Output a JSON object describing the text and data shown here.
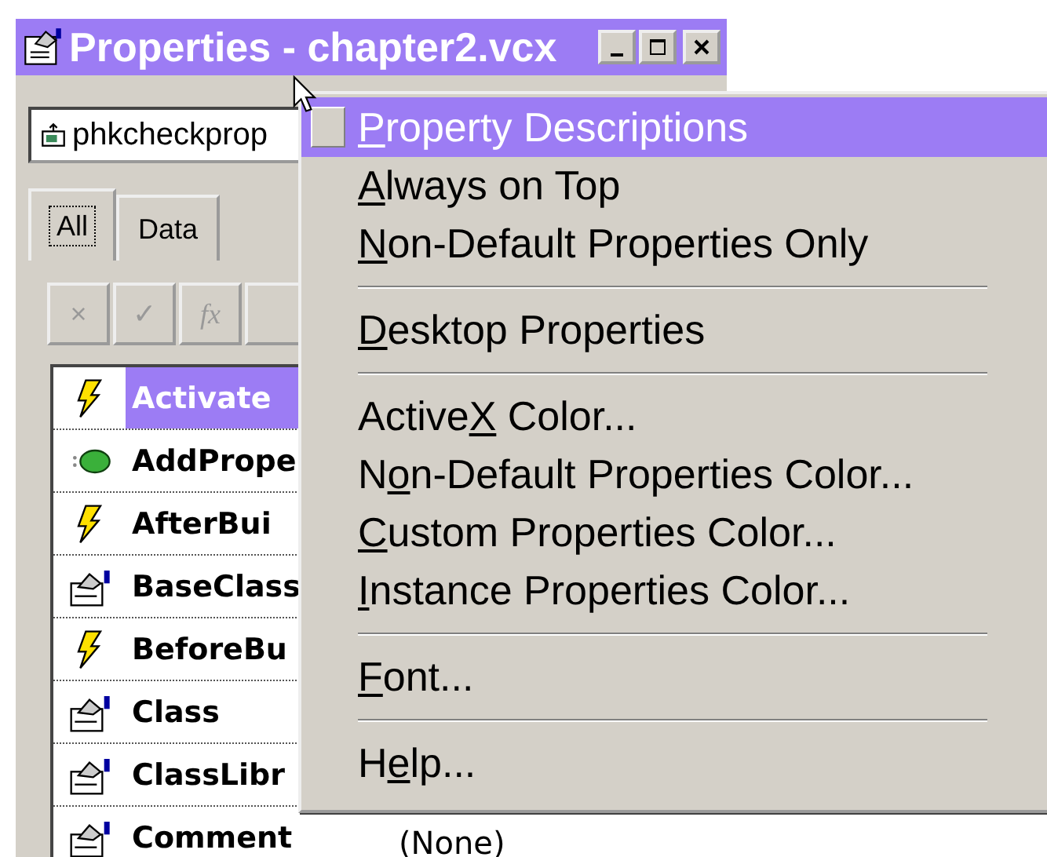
{
  "window": {
    "title": "Properties - chapter2.vcx"
  },
  "object_combo": {
    "value": "phkcheckprop"
  },
  "tabs": [
    {
      "label": "All",
      "selected": true
    },
    {
      "label": "Data",
      "selected": false
    }
  ],
  "toolbar": [
    {
      "label": "×"
    },
    {
      "label": "✓"
    },
    {
      "label": "fx"
    }
  ],
  "properties": [
    {
      "name": "Activate",
      "kind": "event",
      "selected": true
    },
    {
      "name": "AddPrope",
      "kind": "method",
      "selected": false
    },
    {
      "name": "AfterBui",
      "kind": "event",
      "selected": false
    },
    {
      "name": "BaseClass",
      "kind": "property",
      "selected": false
    },
    {
      "name": "BeforeBu",
      "kind": "event",
      "selected": false
    },
    {
      "name": "Class",
      "kind": "property",
      "selected": false
    },
    {
      "name": "ClassLibr",
      "kind": "property",
      "selected": false
    },
    {
      "name": "Comment",
      "kind": "property",
      "selected": false,
      "value": "(None)"
    }
  ],
  "menu": {
    "items": [
      {
        "kind": "item",
        "access_key": "P",
        "after": "roperty Descriptions",
        "checked": true,
        "selected": true
      },
      {
        "kind": "item",
        "access_key": "A",
        "after": "lways on Top",
        "checked": false,
        "selected": false
      },
      {
        "kind": "item",
        "access_key": "N",
        "after": "on-Default Properties Only",
        "checked": false,
        "selected": false
      },
      {
        "kind": "separator"
      },
      {
        "kind": "item",
        "access_key": "D",
        "after": "esktop Properties",
        "checked": false,
        "selected": false
      },
      {
        "kind": "separator"
      },
      {
        "kind": "item",
        "before": "Active",
        "access_key": "X",
        "after": " Color...",
        "checked": false,
        "selected": false
      },
      {
        "kind": "item",
        "before": "N",
        "access_key": "o",
        "after": "n-Default Properties Color...",
        "checked": false,
        "selected": false
      },
      {
        "kind": "item",
        "access_key": "C",
        "after": "ustom Properties Color...",
        "checked": false,
        "selected": false
      },
      {
        "kind": "item",
        "access_key": "I",
        "after": "nstance Properties Color...",
        "checked": false,
        "selected": false
      },
      {
        "kind": "separator"
      },
      {
        "kind": "item",
        "access_key": "F",
        "after": "ont...",
        "checked": false,
        "selected": false
      },
      {
        "kind": "separator"
      },
      {
        "kind": "item",
        "before": "H",
        "access_key": "e",
        "after": "lp...",
        "checked": false,
        "selected": false
      }
    ]
  }
}
